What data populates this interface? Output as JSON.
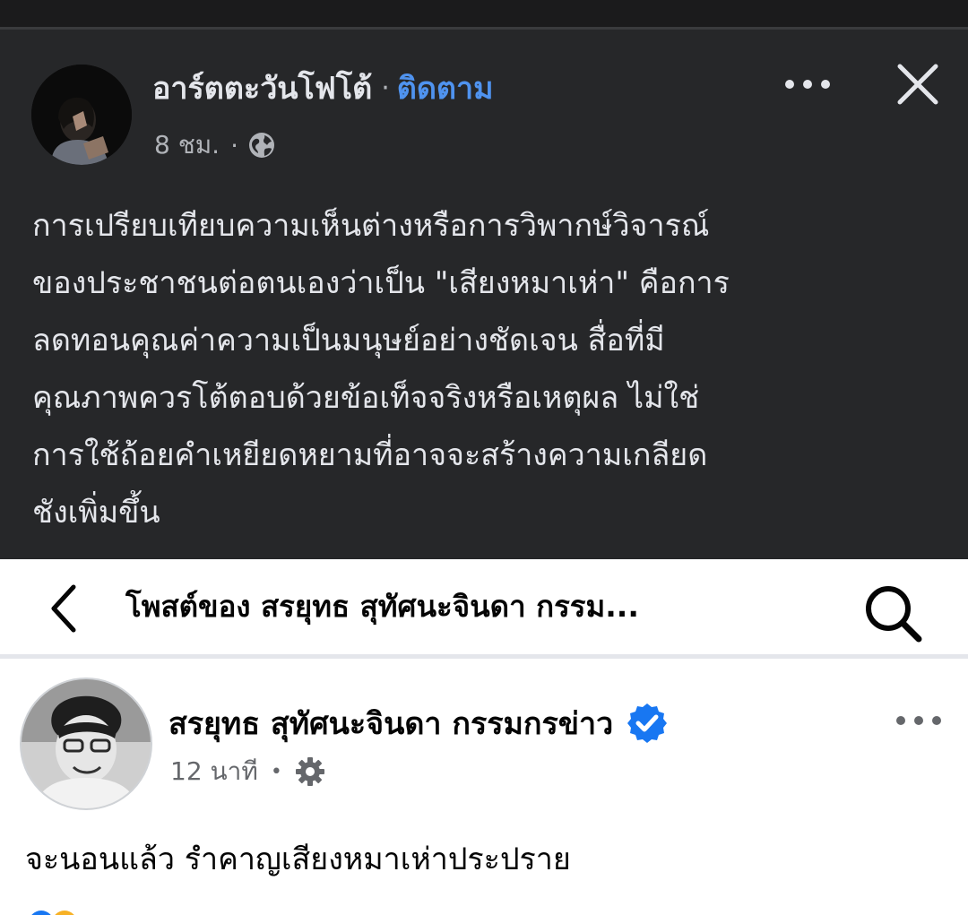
{
  "dark_post": {
    "author": "อาร์ตตะวันโฟโต้",
    "separator": "·",
    "follow_label": "ติดตาม",
    "time": "8 ชม.",
    "time_separator": "·",
    "privacy_icon": "globe-icon",
    "body_lines": [
      "การเปรียบเทียบความเห็นต่างหรือการวิพากษ์วิจารณ์",
      "ของประชาชนต่อตนเองว่าเป็น \"เสียงหมาเห่า\" คือการ",
      "ลดทอนคุณค่าความเป็นมนุษย์อย่างชัดเจน สื่อที่มี",
      "คุณภาพควรโต้ตอบด้วยข้อเท็จจริงหรือเหตุผล ไม่ใช่",
      "การใช้ถ้อยคำเหยียดหยามที่อาจจะสร้างความเกลียด",
      "ชังเพิ่มขึ้น"
    ]
  },
  "header": {
    "title": "โพสต์ของ สรยุทธ สุทัศนะจินดา กรรม..."
  },
  "light_post": {
    "author": "สรยุทธ สุทัศนะจินดา กรรมกรข่าว",
    "verified_icon": "verified-badge-icon",
    "time": "12 นาที",
    "time_separator": "•",
    "privacy_icon": "gear-icon",
    "body": "จะนอนแล้ว รำคาญเสียงหมาเห่าประปราย"
  },
  "colors": {
    "dark_bg": "#262729",
    "dark_text": "#e4e6eb",
    "dark_secondary": "#b0b3b8",
    "follow_blue": "#4f93ef",
    "verified_blue": "#1877f2",
    "light_text": "#050505",
    "light_secondary": "#65676b"
  }
}
